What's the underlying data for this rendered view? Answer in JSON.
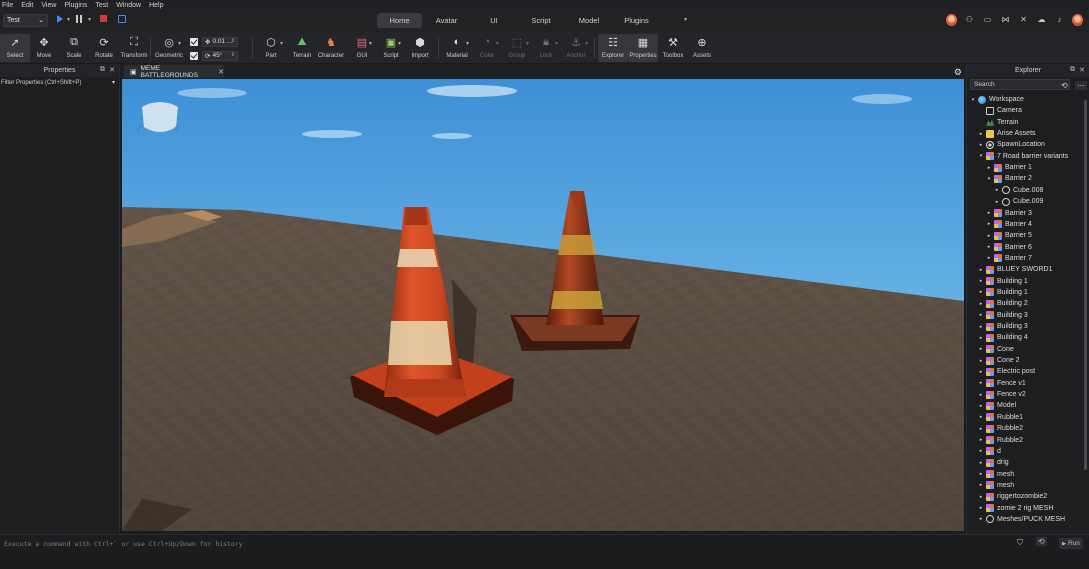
{
  "menu": [
    "File",
    "Edit",
    "View",
    "Plugins",
    "Test",
    "Window",
    "Help"
  ],
  "toolbar": {
    "mode": "Test"
  },
  "tabs": [
    {
      "label": "Home",
      "active": true
    },
    {
      "label": "Avatar",
      "active": false
    },
    {
      "label": "UI",
      "active": false
    },
    {
      "label": "Script",
      "active": false
    },
    {
      "label": "Model",
      "active": false
    },
    {
      "label": "Plugins",
      "active": false
    }
  ],
  "tools": {
    "select": "Select",
    "move": "Move",
    "scale": "Scale",
    "rotate": "Rotate",
    "transform": "Transform",
    "geometric": "Geometric",
    "part": "Part",
    "terrain": "Terrain",
    "character": "Character",
    "gui": "GUI",
    "script": "Script",
    "import": "Import",
    "material": "Material",
    "color": "Color",
    "group": "Group",
    "lock": "Lock",
    "anchor": "Anchor",
    "explorer": "Explorer",
    "properties": "Properties",
    "toolbox": "Toolbox",
    "assets": "Assets"
  },
  "snap": {
    "move": "0.01 ...",
    "rotate": "45°"
  },
  "properties": {
    "title": "Properties",
    "filter": "Filter Properties (Ctrl+Shift+P)"
  },
  "document": {
    "tab": "MEME BATTLEGROUNDS"
  },
  "explorer": {
    "title": "Explorer",
    "search": "Search",
    "items": [
      {
        "label": "Workspace",
        "level": 0,
        "arrow": "▾",
        "icon": "i-world"
      },
      {
        "label": "Camera",
        "level": 1,
        "arrow": "",
        "icon": "i-cam"
      },
      {
        "label": "Terrain",
        "level": 1,
        "arrow": "",
        "icon": "i-terrain"
      },
      {
        "label": "Arise Assets",
        "level": 1,
        "arrow": "▸",
        "icon": "i-folder"
      },
      {
        "label": "SpawnLocation",
        "level": 1,
        "arrow": "▸",
        "icon": "i-spawn"
      },
      {
        "label": "7 Road barrier variants",
        "level": 1,
        "arrow": "▾",
        "icon": "i-model"
      },
      {
        "label": "Barrier 1",
        "level": 2,
        "arrow": "▸",
        "icon": "i-model"
      },
      {
        "label": "Barrier 2",
        "level": 2,
        "arrow": "▾",
        "icon": "i-model"
      },
      {
        "label": "Cube.008",
        "level": 3,
        "arrow": "▸",
        "icon": "i-mesh"
      },
      {
        "label": "Cube.009",
        "level": 3,
        "arrow": "▸",
        "icon": "i-mesh"
      },
      {
        "label": "Barrier 3",
        "level": 2,
        "arrow": "▸",
        "icon": "i-model"
      },
      {
        "label": "Barrier 4",
        "level": 2,
        "arrow": "▸",
        "icon": "i-model"
      },
      {
        "label": "Barrier 5",
        "level": 2,
        "arrow": "▸",
        "icon": "i-model"
      },
      {
        "label": "Barrier 6",
        "level": 2,
        "arrow": "▸",
        "icon": "i-model"
      },
      {
        "label": "Barrier 7",
        "level": 2,
        "arrow": "▸",
        "icon": "i-model"
      },
      {
        "label": "BLUEY SWORD1",
        "level": 1,
        "arrow": "▸",
        "icon": "i-model"
      },
      {
        "label": "Building 1",
        "level": 1,
        "arrow": "▸",
        "icon": "i-model"
      },
      {
        "label": "Building 1",
        "level": 1,
        "arrow": "▸",
        "icon": "i-model"
      },
      {
        "label": "Building 2",
        "level": 1,
        "arrow": "▸",
        "icon": "i-model"
      },
      {
        "label": "Building 3",
        "level": 1,
        "arrow": "▸",
        "icon": "i-model"
      },
      {
        "label": "Building 3",
        "level": 1,
        "arrow": "▸",
        "icon": "i-model"
      },
      {
        "label": "Building 4",
        "level": 1,
        "arrow": "▸",
        "icon": "i-model"
      },
      {
        "label": "Cone",
        "level": 1,
        "arrow": "▸",
        "icon": "i-model"
      },
      {
        "label": "Cone 2",
        "level": 1,
        "arrow": "▸",
        "icon": "i-model"
      },
      {
        "label": "Electric post",
        "level": 1,
        "arrow": "▸",
        "icon": "i-model"
      },
      {
        "label": "Fence v1",
        "level": 1,
        "arrow": "▸",
        "icon": "i-model"
      },
      {
        "label": "Fence v2",
        "level": 1,
        "arrow": "▸",
        "icon": "i-model"
      },
      {
        "label": "Model",
        "level": 1,
        "arrow": "▸",
        "icon": "i-model"
      },
      {
        "label": "Rubble1",
        "level": 1,
        "arrow": "▸",
        "icon": "i-model"
      },
      {
        "label": "Rubble2",
        "level": 1,
        "arrow": "▸",
        "icon": "i-model"
      },
      {
        "label": "Rubble2",
        "level": 1,
        "arrow": "▸",
        "icon": "i-model"
      },
      {
        "label": "d",
        "level": 1,
        "arrow": "▸",
        "icon": "i-model"
      },
      {
        "label": "drig",
        "level": 1,
        "arrow": "▸",
        "icon": "i-model"
      },
      {
        "label": "mesh",
        "level": 1,
        "arrow": "▸",
        "icon": "i-model"
      },
      {
        "label": "mesh",
        "level": 1,
        "arrow": "▸",
        "icon": "i-model"
      },
      {
        "label": "riggertozombie2",
        "level": 1,
        "arrow": "▸",
        "icon": "i-model"
      },
      {
        "label": "zomie 2 rig MESH",
        "level": 1,
        "arrow": "▸",
        "icon": "i-model"
      },
      {
        "label": "Meshes/PUCK MESH",
        "level": 1,
        "arrow": "▸",
        "icon": "i-mesh"
      }
    ]
  },
  "command": {
    "placeholder": "Execute a command with Ctrl+` or use Ctrl+Up/Down for history",
    "run": "Run"
  }
}
